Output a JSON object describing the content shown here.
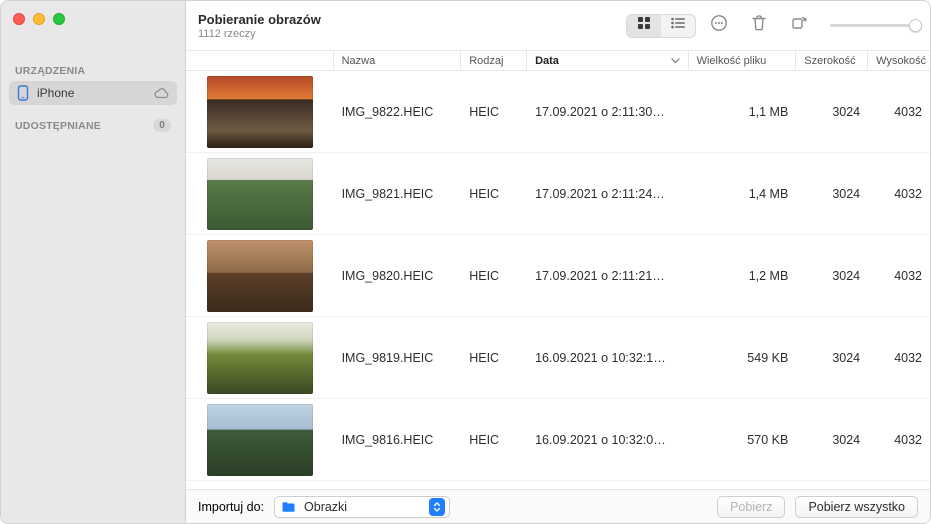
{
  "header": {
    "title": "Pobieranie obrazów",
    "subtitle": "1112 rzeczy"
  },
  "sidebar": {
    "section_devices": "URZĄDZENIA",
    "device_name": "iPhone",
    "section_shared": "UDOSTĘPNIANE",
    "shared_count": "0"
  },
  "columns": {
    "name": "Nazwa",
    "kind": "Rodzaj",
    "date": "Data",
    "size": "Wielkość pliku",
    "width": "Szerokość",
    "height": "Wysokość"
  },
  "rows": [
    {
      "name": "IMG_9822.HEIC",
      "kind": "HEIC",
      "date": "17.09.2021 o 2:11:30…",
      "size": "1,1 MB",
      "w": "3024",
      "h": "4032",
      "thumb": "t1"
    },
    {
      "name": "IMG_9821.HEIC",
      "kind": "HEIC",
      "date": "17.09.2021 o 2:11:24…",
      "size": "1,4 MB",
      "w": "3024",
      "h": "4032",
      "thumb": "t2"
    },
    {
      "name": "IMG_9820.HEIC",
      "kind": "HEIC",
      "date": "17.09.2021 o 2:11:21…",
      "size": "1,2 MB",
      "w": "3024",
      "h": "4032",
      "thumb": "t3"
    },
    {
      "name": "IMG_9819.HEIC",
      "kind": "HEIC",
      "date": "16.09.2021 o 10:32:1…",
      "size": "549 KB",
      "w": "3024",
      "h": "4032",
      "thumb": "t4"
    },
    {
      "name": "IMG_9816.HEIC",
      "kind": "HEIC",
      "date": "16.09.2021 o 10:32:0…",
      "size": "570 KB",
      "w": "3024",
      "h": "4032",
      "thumb": "t5"
    }
  ],
  "footer": {
    "import_to_label": "Importuj do:",
    "destination": "Obrazki",
    "download": "Pobierz",
    "download_all": "Pobierz wszystko"
  }
}
